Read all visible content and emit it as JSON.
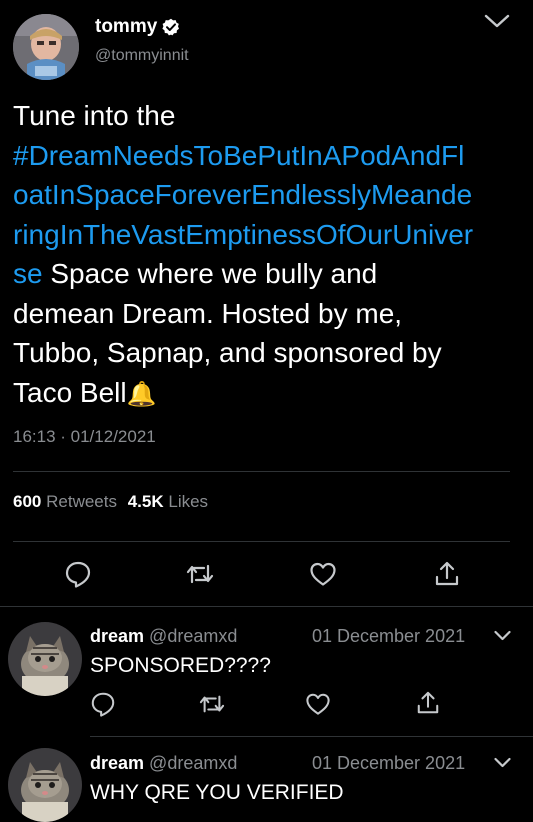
{
  "tweet": {
    "author_name": "tommy",
    "author_handle": "@tommyinnit",
    "text_intro": "Tune into the",
    "hashtag_lines": [
      "#DreamNeedsToBePutInAPodAndFl",
      "oatInSpaceForeverEndlesslyMeande",
      "ringInTheVastEmptinessOfOurUniver"
    ],
    "hashtag_tail": "se",
    "text_line4_rest": " Space where we bully and",
    "text_lines": [
      "demean Dream. Hosted by me,",
      "Tubbo, Sapnap, and sponsored by"
    ],
    "text_last": "Taco Bell",
    "emoji": "🔔",
    "timestamp": "16:13 · 01/12/2021",
    "retweets_count": "600",
    "retweets_label": "Retweets",
    "likes_count": "4.5K",
    "likes_label": "Likes"
  },
  "replies": [
    {
      "name": "dream",
      "handle": "@dreamxd",
      "date": "01 December 2021",
      "text": "SPONSORED????"
    },
    {
      "name": "dream",
      "handle": "@dreamxd",
      "date": "01 December 2021",
      "text": "WHY QRE YOU VERIFIED"
    }
  ],
  "colors": {
    "background": "#000000",
    "link": "#1d9bf0",
    "muted": "#8a8d91",
    "divider": "#2f3336",
    "icon": "#c6c9cc"
  },
  "icons": {
    "verified": "verified-badge-icon",
    "chevron": "chevron-down-icon",
    "reply": "reply-icon",
    "retweet": "retweet-icon",
    "like": "heart-icon",
    "share": "share-icon"
  }
}
